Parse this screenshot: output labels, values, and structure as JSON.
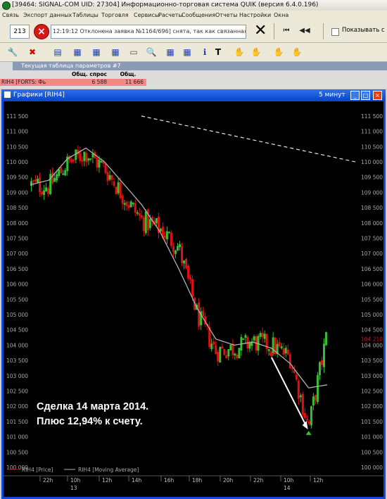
{
  "window": {
    "title": "[39464: SIGNAL-COM UID: 27304] Информационно-торговая система QUIK (версия 6.4.0.196)"
  },
  "menu": [
    "Связь",
    "Экспорт данных",
    "Таблицы",
    "Торговля",
    "Сервисы",
    "Расчеты",
    "Сообщения",
    "Отчеты",
    "Настройки",
    "Окна"
  ],
  "toolbar1": {
    "field_value": "213",
    "message": "12:19:12 Отклонена заявка №1164/696] снята, так как связанная заявка ис",
    "checkbox_label": "Показывать с"
  },
  "icons": {
    "app": "quik-logo-icon",
    "stop": "stop-icon",
    "close_all": "big-x-icon",
    "first": "first-page-icon",
    "prev": "prev-page-icon",
    "toolbar2": [
      "wrench-icon",
      "disconnect-icon",
      "chart-icon",
      "table-icon",
      "table-icon",
      "table-icon",
      "calculator-icon",
      "search-icon",
      "table-icon",
      "table-icon",
      "table-icon",
      "info-icon",
      "text-icon",
      "hand-icon",
      "hand-icon",
      "hand-icon",
      "hand-icon"
    ]
  },
  "param_table": {
    "title": "Текущая таблица параметров #7",
    "headers": [
      "Общ. спрос",
      "Общ. предл."
    ],
    "row": {
      "name": "RIH4 [FORTS: Фь",
      "demand": "6 588",
      "supply": "11 666"
    }
  },
  "chart_window": {
    "title": "Графики [RIH4]",
    "timeframe": "5 минут"
  },
  "colors": {
    "bull": "#33c033",
    "bear": "#e01010",
    "ma": "#b0b0b0",
    "chart_bg": "#000000",
    "titlebar": "#0a46c8"
  },
  "chart_data": {
    "type": "candlestick",
    "y_ticks_left": [
      "111 500",
      "111 000",
      "110 500",
      "110 000",
      "109 500",
      "109 000",
      "108 500",
      "108 000",
      "107 500",
      "107 000",
      "106 500",
      "106 000",
      "105 500",
      "105 000",
      "104 500",
      "104 000",
      "103 500",
      "103 000",
      "102 500",
      "102 000",
      "101 500",
      "101 000",
      "100 500",
      "100 000"
    ],
    "y_ticks_right": [
      "111 500",
      "111 000",
      "110 500",
      "110 000",
      "109 500",
      "109 000",
      "108 500",
      "108 000",
      "107 500",
      "107 000",
      "106 500",
      "106 000",
      "105 500",
      "105 000",
      "104 500",
      "104 000",
      "103 500",
      "103 000",
      "102 500",
      "102 000",
      "101 500",
      "101 000",
      "100 500",
      "100 000"
    ],
    "last_price": "104 210",
    "ylim": [
      100000,
      111750
    ],
    "x_ticks": [
      "22h",
      "10h",
      "12h",
      "14h",
      "16h",
      "18h",
      "20h",
      "22h",
      "10h",
      "12h"
    ],
    "x_day_labels": [
      "13",
      "14"
    ],
    "price_anchor": {
      "x_hours": [
        0,
        1,
        2,
        3,
        4,
        5,
        6,
        7,
        8,
        9,
        10,
        11,
        12,
        13,
        14,
        15,
        16
      ],
      "close": [
        109250,
        109200,
        109950,
        110300,
        109800,
        108900,
        108100,
        107800,
        107200,
        105000,
        103800,
        103900,
        104100,
        104000,
        103600,
        101300,
        104400
      ]
    },
    "ma_anchor": {
      "x_hours": [
        0,
        1,
        2,
        3,
        4,
        5,
        6,
        7,
        8,
        9,
        10,
        11,
        12,
        13,
        14,
        15,
        16
      ],
      "value": [
        109250,
        109400,
        110100,
        110450,
        110000,
        109300,
        108600,
        107700,
        106500,
        105200,
        104200,
        104000,
        104100,
        103900,
        103400,
        102600,
        102700
      ]
    },
    "trendline": {
      "from": [
        2,
        111500
      ],
      "to": [
        16,
        110000
      ]
    },
    "entry_marker": {
      "x": 13,
      "price": 103600,
      "type": "sell"
    },
    "exit_marker": {
      "x": 15,
      "price": 101150,
      "type": "buy"
    },
    "annotation": [
      "Сделка 14 марта 2014.",
      "Плюс 12,94% к счету."
    ],
    "legend": [
      "RIH4 [Price]",
      "RIH4 [Moving Average]"
    ]
  }
}
